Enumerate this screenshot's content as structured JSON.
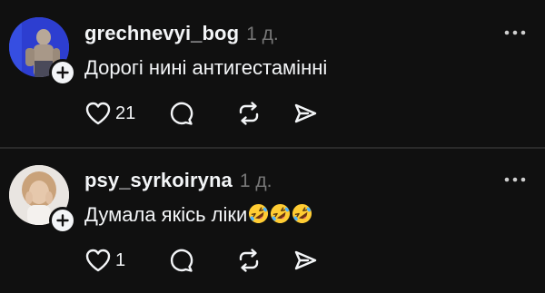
{
  "posts": [
    {
      "username": "grechnevyi_bog",
      "time": "1 д.",
      "text": "Дорогі нині антигестамінні",
      "likes": "21",
      "emojis": []
    },
    {
      "username": "psy_syrkoiryna",
      "time": "1 д.",
      "text": "Думала якісь ліки",
      "likes": "1",
      "emojis": [
        "rolling-on-floor-laughing",
        "rolling-on-floor-laughing",
        "rolling-on-floor-laughing"
      ]
    }
  ],
  "colors": {
    "background": "#101010",
    "text": "#f3f5f7",
    "secondary": "#777777",
    "divider": "#2a2a2a"
  }
}
